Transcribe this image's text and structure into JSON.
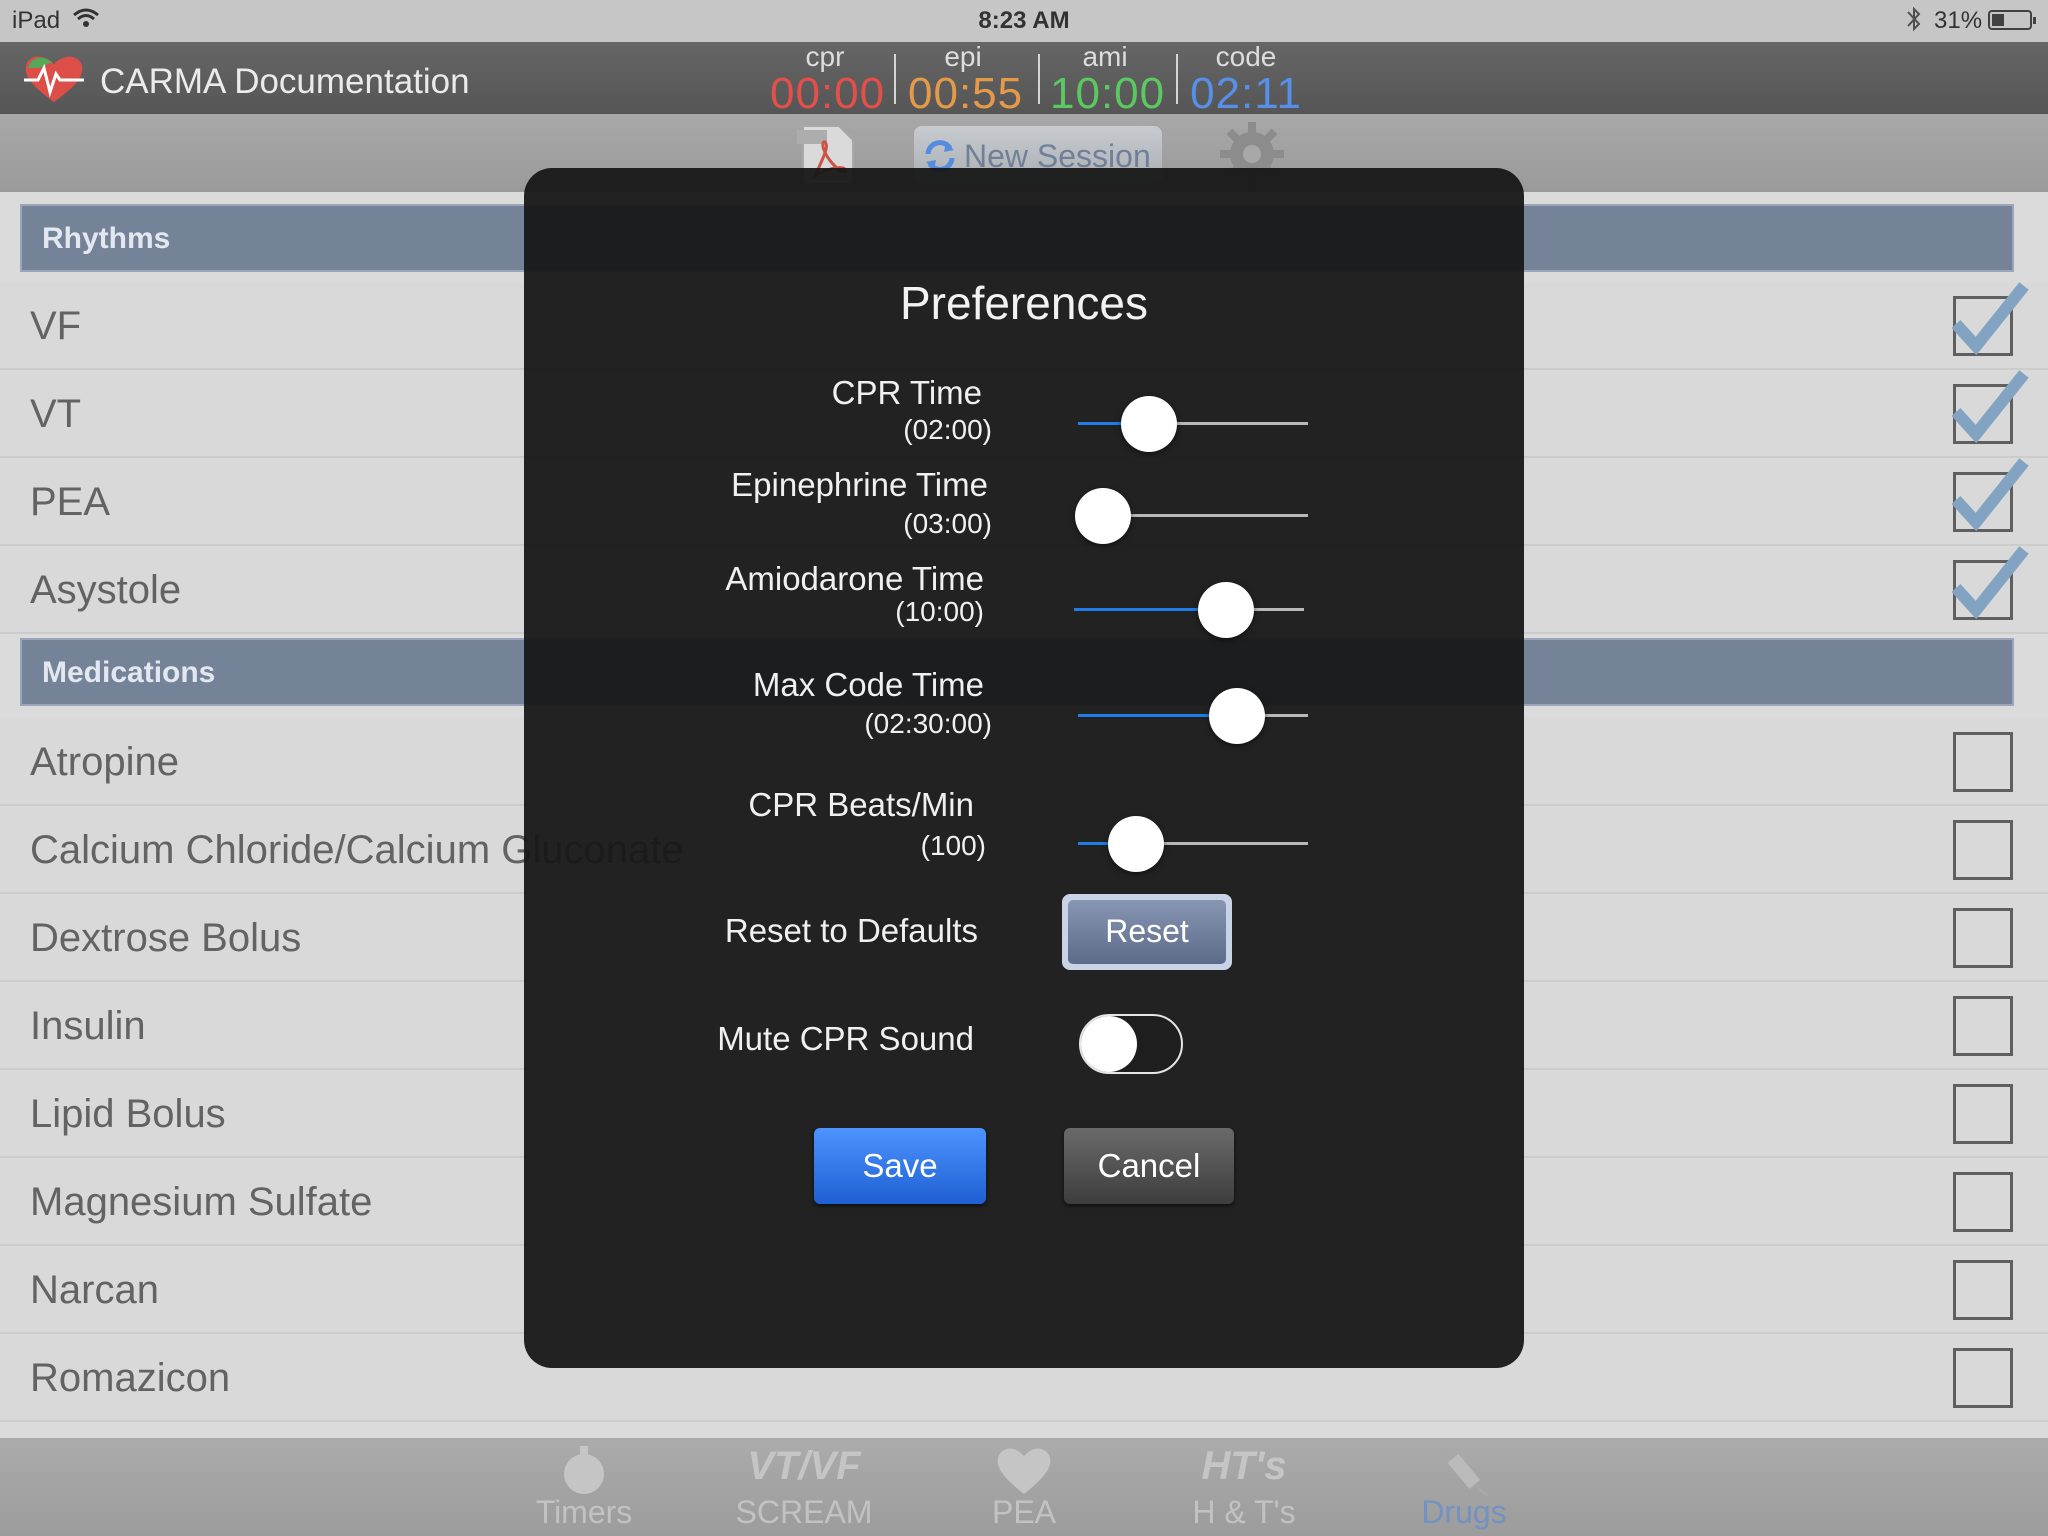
{
  "status_bar": {
    "device": "iPad",
    "time": "8:23 AM",
    "battery": "31%"
  },
  "app": {
    "title": "CARMA Documentation"
  },
  "timers": [
    {
      "label": "cpr",
      "value": "00:00",
      "color": "#e0342c"
    },
    {
      "label": "epi",
      "value": "00:55",
      "color": "#e08a2c"
    },
    {
      "label": "ami",
      "value": "10:00",
      "color": "#3fc049"
    },
    {
      "label": "code",
      "value": "02:11",
      "color": "#3c7ee6"
    }
  ],
  "toolbar": {
    "new_session_label": "New Session"
  },
  "list": {
    "rhythms_header": "Rhythms",
    "rhythms": [
      {
        "label": "VF",
        "checked": true
      },
      {
        "label": "VT",
        "checked": true
      },
      {
        "label": "PEA",
        "checked": true
      },
      {
        "label": "Asystole",
        "checked": true
      }
    ],
    "medications_header": "Medications",
    "medications": [
      {
        "label": "Atropine",
        "checked": false
      },
      {
        "label": "Calcium Chloride/Calcium Gluconate",
        "checked": false
      },
      {
        "label": "Dextrose Bolus",
        "checked": false
      },
      {
        "label": "Insulin",
        "checked": false
      },
      {
        "label": "Lipid Bolus",
        "checked": false
      },
      {
        "label": "Magnesium Sulfate",
        "checked": false
      },
      {
        "label": "Narcan",
        "checked": false
      },
      {
        "label": "Romazicon",
        "checked": false
      }
    ]
  },
  "tabs": [
    {
      "label": "Timers",
      "icon": "stopwatch-icon",
      "active": false
    },
    {
      "label": "SCREAM",
      "icon": "vt-vf-icon",
      "icon_text": "VT/VF",
      "active": false
    },
    {
      "label": "PEA",
      "icon": "heart-icon",
      "active": false
    },
    {
      "label": "H & T's",
      "icon": "hts-icon",
      "icon_text": "HT's",
      "active": false
    },
    {
      "label": "Drugs",
      "icon": "syringe-icon",
      "active": true
    }
  ],
  "modal": {
    "title": "Preferences",
    "prefs": [
      {
        "label": "CPR Time",
        "value": "(02:00)",
        "fraction": 0.31
      },
      {
        "label": "Epinephrine Time",
        "value": "(03:00)",
        "fraction": 0.11
      },
      {
        "label": "Amiodarone Time",
        "value": "(10:00)",
        "fraction": 0.66
      },
      {
        "label": "Max Code Time",
        "value": "(02:30:00)",
        "fraction": 0.69
      },
      {
        "label": "CPR Beats/Min",
        "value": "(100)",
        "fraction": 0.25
      }
    ],
    "reset_label": "Reset to Defaults",
    "reset_button": "Reset",
    "mute_label": "Mute CPR Sound",
    "mute_on": false,
    "save_button": "Save",
    "cancel_button": "Cancel"
  }
}
